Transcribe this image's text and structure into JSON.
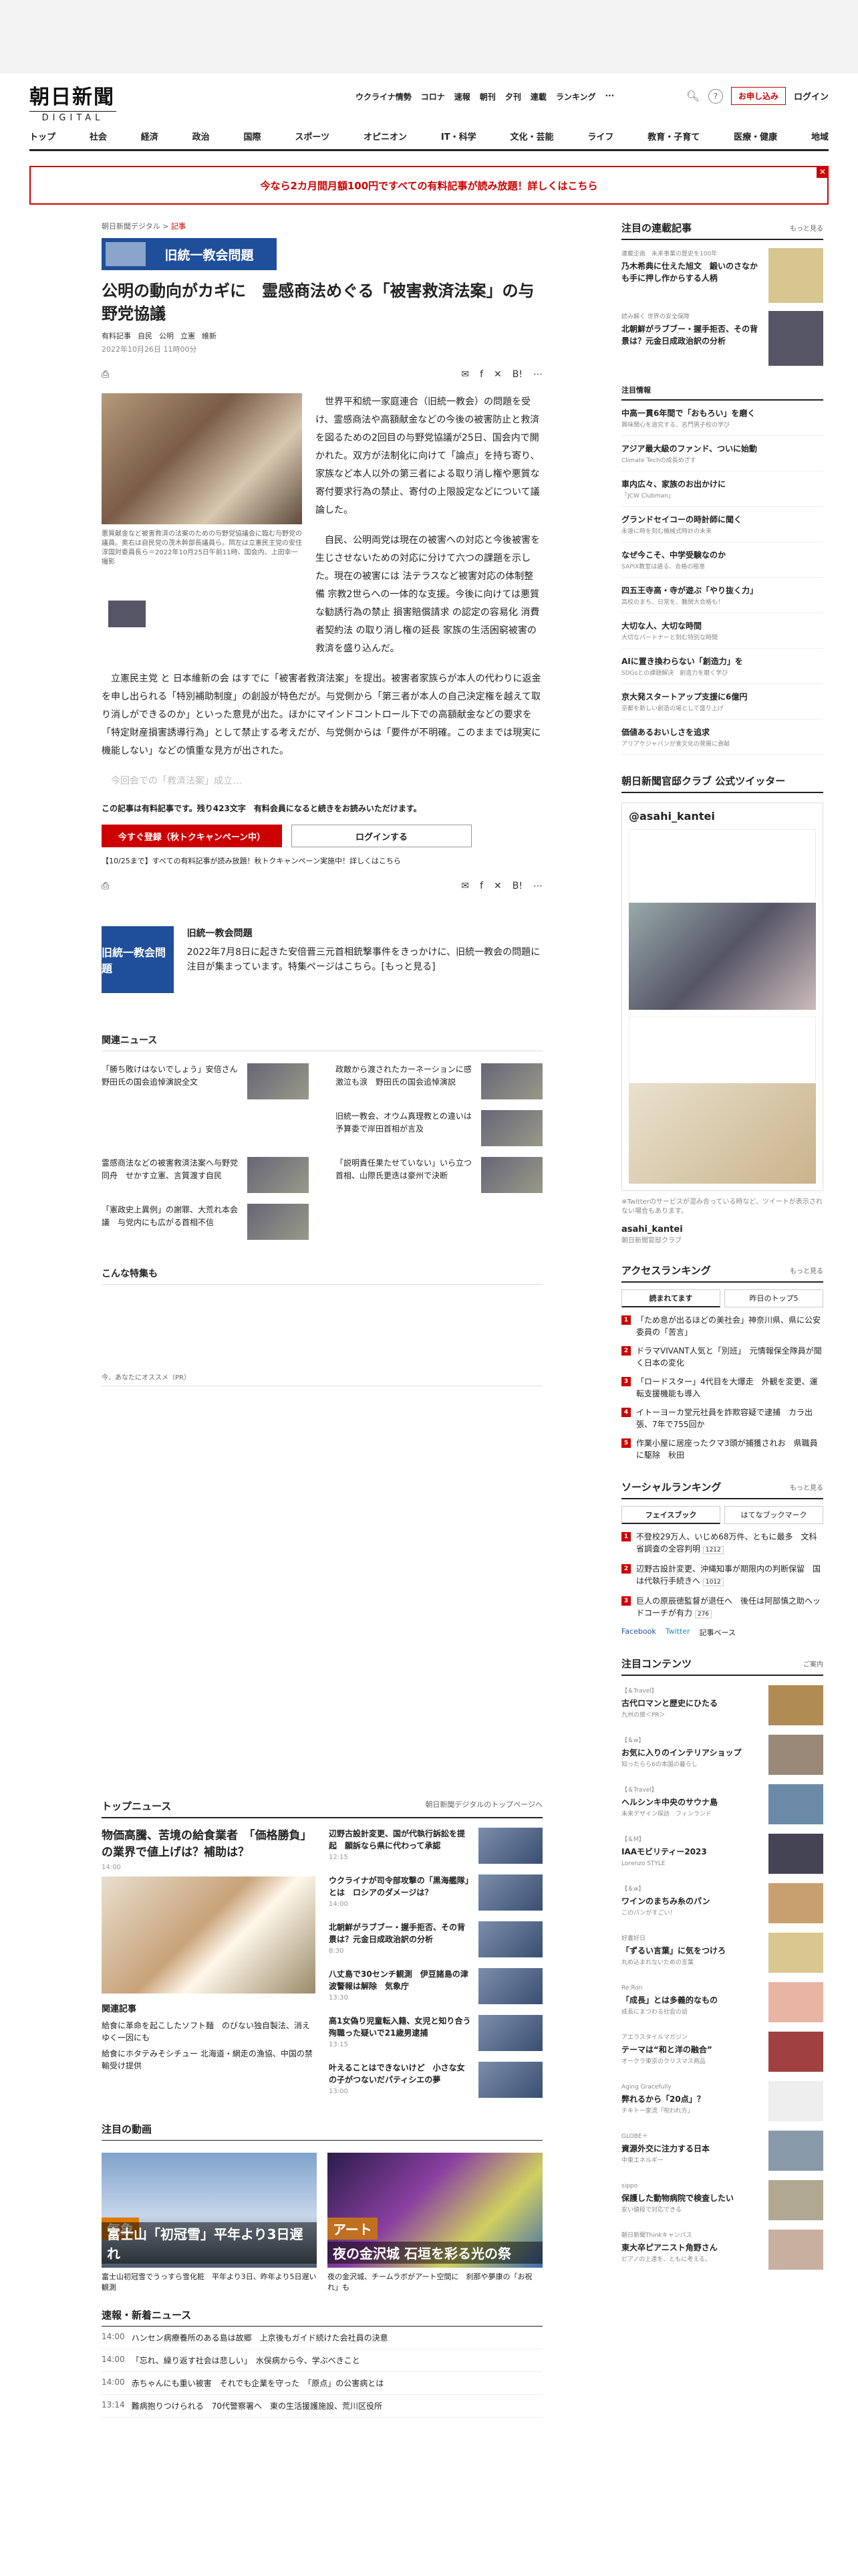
{
  "header": {
    "logo_jp": "朝日新聞",
    "logo_en": "DIGITAL",
    "quick_links": [
      "ウクライナ情勢",
      "コロナ",
      "速報",
      "朝刊",
      "夕刊",
      "連載",
      "ランキング",
      "···"
    ],
    "subscribe": "お申し込み",
    "login": "ログイン"
  },
  "nav": [
    "トップ",
    "社会",
    "経済",
    "政治",
    "国際",
    "スポーツ",
    "オピニオン",
    "IT・科学",
    "文化・芸能",
    "ライフ",
    "教育・子育て",
    "医療・健康",
    "地域"
  ],
  "banner": "今なら2カ月間月額100円ですべての有料記事が読み放題！詳しくはこちら",
  "article": {
    "crumb_site": "朝日新聞デジタル",
    "crumb_section": "記事",
    "topic_banner": "旧統一教会問題",
    "title": "公明の動向がカギに　霊感商法めぐる「被害救済法案」の与野党協議",
    "tags": [
      "有料記事",
      "自民",
      "公明",
      "立憲",
      "維新"
    ],
    "date": "2022年10月26日 11時00分",
    "caption": "悪質献金など被害救済の法案のための与野党協議会に臨む与野党の議員。奥右は自民党の茂木幹部長議員ら。岡左は立憲民主党の安住淳国対委員長ら＝2022年10月25日午前11時、国会内、上田幸一撮影",
    "paragraphs": [
      "世界平和統一家庭連合（旧統一教会）の問題を受け、霊感商法や高額献金などの今後の被害防止と救済を図るための2回目の与野党協議が25日、国会内で開かれた。双方が法制化に向けて「論点」を持ち寄り、家族など本人以外の第三者による取り消し権や悪質な寄付要求行為の禁止、寄付の上限設定などについて議論した。",
      "自民、公明両党は現在の被害への対応と今後被害を生じさせないための対応に分けて六つの課題を示した。現在の被害には 法テラスなど被害対応の体制整備 宗教2世らへの一体的な支援。今後に向けては悪質な勧誘行為の禁止 損害賠償請求 の認定の容易化 消費者契約法 の取り消し権の延長 家族の生活困窮被害の救済を盛り込んだ。",
      "立憲民主党 と 日本維新の会 はすでに「被害者救済法案」を提出。被害者家族らが本人の代わりに返金を申し出られる「特別補助制度」の創設が特色だが。与党側から「第三者が本人の自己決定権を越えて取り消しができるのか」といった意見が出た。ほかにマインドコントロール下での高額献金などの要求を「特定財産損害誘導行為」として禁止する考えだが、与党側からは「要件が不明確。このままでは現実に機能しない」などの慎重な見方が出された。",
      "今回会での「救済法案」成立…"
    ],
    "pay_note": "この記事は有料記事です。残り423文字　有料会員になると続きをお読みいただけます。",
    "register": "今すぐ登録（秋トクキャンペーン中）",
    "login": "ログインする",
    "campaign": "【10/25まで】すべての有料記事が読み放題！秋トクキャンペーン実施中！詳しくはこちら",
    "share_counts": [
      "list",
      "1"
    ]
  },
  "feature": {
    "image_label": "旧統一教会問題",
    "title": "旧統一教会問題",
    "desc": "2022年7月8日に起きた安倍晋三元首相銃撃事件をきっかけに、旧統一教会の問題に注目が集まっています。特集ページはこちら。[もっと見る]"
  },
  "related": {
    "heading": "関連ニュース",
    "items": [
      "「勝ち敗けはないでしょう」安倍さん　野田氏の国会追悼演説全文",
      "政敵から渡されたカーネーションに感激泣も涙　野田氏の国会追悼演説",
      "旧統一教会、オウム真理教との違いは　予算委で岸田首相が言及",
      "霊感商法などの被害救済法案へ与野党同舟　せかす立憲、言質渡す自民",
      "「説明責任果たせていない」いら立つ首相、山際氏更迭は豪州で決断",
      "「憲政史上異例」の謝罪、大荒れ本会議　与党内にも広がる首相不信"
    ]
  },
  "more_heading": "こんな特集も",
  "pr_note": "今、あなたにオススメ（PR）",
  "top_news": {
    "heading": "トップニュース",
    "link": "朝日新聞デジタルのトップページへ",
    "lead": "物価高騰、苦境の給食業者　「価格勝負」の業界で値上げは？補助は？",
    "lead_time": "14:00",
    "related_heading": "関連記事",
    "related": [
      "給食に革命を起こしたソフト麺　のびない独自製法、消えゆく一因にも",
      "給食にホタテみそシチュー 北海道・網走の漁協、中国の禁輸受け提供"
    ],
    "items": [
      {
        "t": "辺野古設計変更、国が代執行訴訟を提起　願訴なら県に代わって承認",
        "time": "12:15"
      },
      {
        "t": "ウクライナが司令部攻撃の「黒海艦隊」とは　ロシアのダメージは？",
        "time": "14:00"
      },
      {
        "t": "北朝鮮がラブブー・握手拒否、その背景は？元金日成政治訳の分析",
        "time": "8:30"
      },
      {
        "t": "八丈島で30センチ観測　伊豆諸島の津波警報は解除　気象庁",
        "time": "13:30"
      },
      {
        "t": "高1女偽り児童転入籍、女児と知り合う　殉職った疑いで21歳男逮捕",
        "time": "13:15"
      },
      {
        "t": "叶えることはできないけど　小さな女の子がつないだパティシエの夢",
        "time": "13:00"
      }
    ]
  },
  "videos": {
    "heading": "注目の動画",
    "items": [
      {
        "cat": "気象",
        "title": "富士山「初冠雪」平年より3日遅れ",
        "desc": "富士山初冠雪でうっすら雪化粧　平年より3日、昨年より5日遅い観測"
      },
      {
        "cat": "アート",
        "title": "夜の金沢城 石垣を彩る光の祭",
        "desc": "夜の金沢城、チームラボがアート空間に　刹那や夢康の「お祝れ」も"
      }
    ]
  },
  "flash": {
    "heading": "速報・新着ニュース",
    "items": [
      {
        "time": "14:00",
        "t": "ハンセン病療養所のある島は故郷　上京後もガイド続けた会社員の決意"
      },
      {
        "time": "14:00",
        "t": "「忘れ、繰り返す社会は悲しい」　水俣病から今、学ぶべきこと"
      },
      {
        "time": "14:00",
        "t": "赤ちゃんにも重い被害　それでも企業を守った　「原点」の公害病とは"
      },
      {
        "time": "13:14",
        "t": "難病抱りつけられる　70代警察署へ　東の生活援護施設、荒川区役所"
      }
    ]
  },
  "side": {
    "series_heading": "注目の連載記事",
    "more": "もっと見る",
    "series": [
      {
        "sub": "連載企画　未来事業の歴史を100年",
        "t": "乃木希典に仕えた旭文　鍛いのさなかも手に押し作からする人柄"
      },
      {
        "sub": "読み解く 世界の安全保障",
        "t": "北朝鮮がラブブー・握手拒否、その背景は？元金日成政治訳の分析"
      }
    ],
    "info_heading": "注目情報",
    "info": [
      {
        "t": "中高一貫6年間で「おもろい」を磨く",
        "s": "興味関心を追究する、名門男子校の学び"
      },
      {
        "t": "アジア最大級のファンド、ついに始動",
        "s": "Climate Techの成長めざす"
      },
      {
        "t": "車内広々、家族のお出かけに",
        "s": "「JCW Clubman」"
      },
      {
        "t": "グランドセイコーの時計師に聞く",
        "s": "永遠に時を刻む機械式時計の未来"
      },
      {
        "t": "なぜ今こそ、中学受験なのか",
        "s": "SAPIX教室は語る、合格の極意"
      },
      {
        "t": "四五王寺高・寺が遊ぶ「やり抜く力」",
        "s": "高校のまち、日常を、難関大合格も！"
      },
      {
        "t": "大切な人、大切な時間",
        "s": "大切なパートナーと刻む特別な時間"
      },
      {
        "t": "AIに置き換わらない「創造力」を",
        "s": "SDGsとの課題解決　創造力を磨く学び"
      },
      {
        "t": "京大発スタートアップ支援に6億円",
        "s": "京都を新しい創造の場として盛り上げ"
      },
      {
        "t": "価値あるおいしさを追求",
        "s": "アリアケジャパンが食文化の発展に貢献"
      }
    ],
    "twitter_heading": "朝日新聞官邸クラブ 公式ツイッター",
    "twitter_account": "@asahi_kantei",
    "tw_note": "※Twitterのサービスが混み合っている時など、ツイートが表示されない場合もあります。",
    "tw_footer": "asahi_kantei",
    "tw_footer_sub": "朝日新聞官邸クラブ",
    "access_heading": "アクセスランキング",
    "tabs": [
      "読まれてます",
      "昨日のトップ5"
    ],
    "access": [
      "「ため息が出るほどの美社会」神奈川県、県に公安委員の「苦言」",
      "ドラマVIVANT人気と「別班」　元情報保全隊員が聞く日本の変化",
      "「ロードスター」4代目を大爆走　外観を変更、運転支援機能も導入",
      "イトーヨーカ堂元社員を詐欺容疑で逮捕　カラ出張、7年で755回か",
      "作業小屋に居座ったクマ3頭が捕獲されお　県職員に駆除　秋田"
    ],
    "social_heading": "ソーシャルランキング",
    "social_tabs": [
      "フェイスブック",
      "はてなブックマーク"
    ],
    "social": [
      {
        "t": "不登校29万人、いじめ68万件、ともに最多　文科省調査の全容判明",
        "c": "1212"
      },
      {
        "t": "辺野古設計変更、沖縄知事が期限内の判断保留　国は代執行手続きへ",
        "c": "1012"
      },
      {
        "t": "巨人の原辰徳監督が退任へ　後任は阿部慎之助ヘッドコーチが有力",
        "c": "276"
      }
    ],
    "social_links": [
      "Facebook",
      "Twitter",
      "記事ベース"
    ],
    "content_heading": "注目コンテンツ",
    "content_more": "ご案内",
    "contents": [
      {
        "s": "【＆Travel】",
        "t": "古代ロマンと歴史にひたる",
        "d": "九州の旅＜PR＞"
      },
      {
        "s": "【＆w】",
        "t": "お気に入りのインテリアショップ",
        "d": "知ったらら6の本国の暮らし"
      },
      {
        "s": "【＆Travel】",
        "t": "ヘルシンキ中央のサウナ島",
        "d": "未来デザイン探訪　フィンランド"
      },
      {
        "s": "【＆M】",
        "t": "IAAモビリティー2023",
        "d": "Lorenzo STYLE"
      },
      {
        "s": "【＆w】",
        "t": "ワインのまちみ糸のパン",
        "d": "このパンがすごい！"
      },
      {
        "s": "好書好日",
        "t": "「ずるい言葉」に気をつけろ",
        "d": "丸め込まれないための言葉"
      },
      {
        "s": "Re:Ron",
        "t": "「成長」とは多義的なもの",
        "d": "成長にまつわる社会の話"
      },
      {
        "s": "アエラスタイルマガジン",
        "t": "テーマは“和と洋の融合”",
        "d": "オークラ東京のクリスマス商品"
      },
      {
        "s": "Aging Gracefully",
        "t": "弊れるから「20点」？",
        "d": "チキト一家流「呪われ方」"
      },
      {
        "s": "GLOBE＋",
        "t": "資源外交に注力する日本",
        "d": "中東エネルギー"
      },
      {
        "s": "sippo",
        "t": "保護した動物病院で検査したい",
        "d": "安い値段で対応できる"
      },
      {
        "s": "朝日新聞Thinkキャンパス",
        "t": "東大卒ピアニスト角野さん",
        "d": "ピアノの上達を、ともに考える。"
      }
    ]
  }
}
